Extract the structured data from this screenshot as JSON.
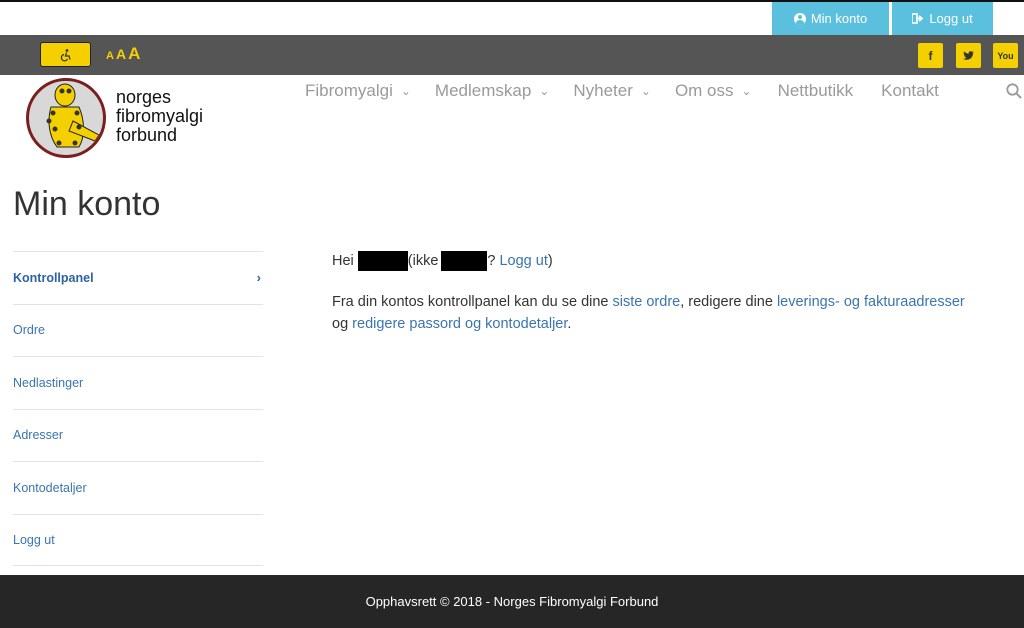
{
  "topbar": {
    "min_konto_label": "Min konto",
    "logg_ut_label": "Logg ut"
  },
  "accessibility": {
    "font_sizes": [
      "A",
      "A",
      "A"
    ]
  },
  "social": {
    "facebook": "f",
    "twitter": "t",
    "youtube": "You"
  },
  "logo": {
    "line1": "norges",
    "line2": "fibromyalgi",
    "line3": "forbund"
  },
  "nav": {
    "items": [
      {
        "label": "Fibromyalgi",
        "has_dropdown": true
      },
      {
        "label": "Medlemskap",
        "has_dropdown": true
      },
      {
        "label": "Nyheter",
        "has_dropdown": true
      },
      {
        "label": "Om oss",
        "has_dropdown": true
      },
      {
        "label": "Nettbutikk",
        "has_dropdown": false
      },
      {
        "label": "Kontakt",
        "has_dropdown": false
      }
    ]
  },
  "page": {
    "title": "Min konto"
  },
  "sidebar": {
    "items": [
      {
        "label": "Kontrollpanel",
        "active": true
      },
      {
        "label": "Ordre"
      },
      {
        "label": "Nedlastinger"
      },
      {
        "label": "Adresser"
      },
      {
        "label": "Kontodetaljer"
      },
      {
        "label": "Logg ut"
      }
    ]
  },
  "content": {
    "hello_prefix": "Hei",
    "not_prefix": "(ikke",
    "question_mark": "?",
    "logout_link": "Logg ut",
    "closing_paren": ")",
    "para_part1": "Fra din kontos kontrollpanel kan du se dine ",
    "link_orders": "siste ordre",
    "para_part2": ", redigere dine ",
    "link_addresses": "leverings- og fakturaadresser",
    "para_part3": "og ",
    "link_password": "redigere passord og kontodetaljer",
    "para_part4": "."
  },
  "footer": {
    "copyright": "Opphavsrett © 2018 - Norges Fibromyalgi Forbund"
  },
  "colors": {
    "top_button": "#5bc0de",
    "accent_yellow": "#f5d000",
    "link": "#3a75b0",
    "footer_bg": "#262626",
    "access_bar": "#555555"
  }
}
